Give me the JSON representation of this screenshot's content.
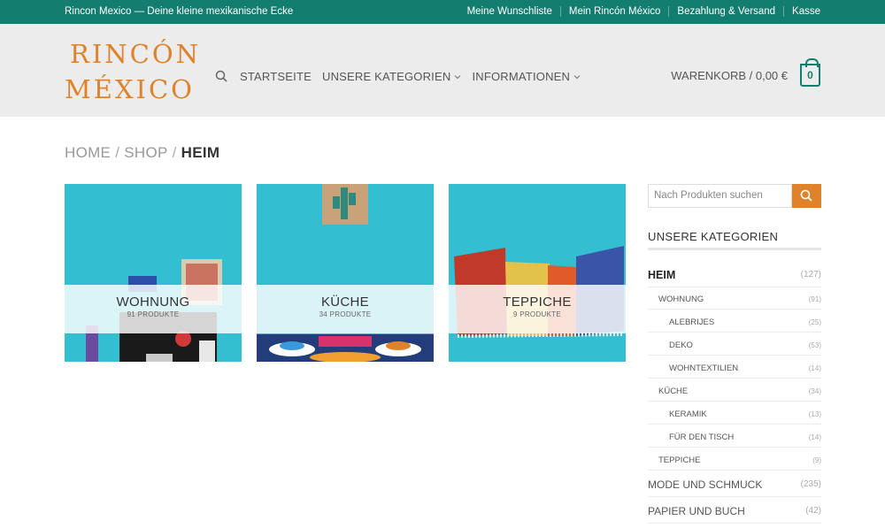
{
  "topbar": {
    "tagline": "Rincon Mexico — Deine kleine mexikanische Ecke",
    "links": [
      "Meine Wunschliste",
      "Mein Rincón México",
      "Bezahlung & Versand",
      "Kasse"
    ]
  },
  "logo": {
    "line1": "RINCÓN",
    "line2": "MÉXICO"
  },
  "nav": {
    "home": "STARTSEITE",
    "categories": "UNSERE KATEGORIEN",
    "info": "INFORMATIONEN"
  },
  "cart": {
    "label": "WARENKORB / 0,00 €",
    "count": "0"
  },
  "breadcrumb": {
    "home": "HOME",
    "shop": "SHOP",
    "current": "HEIM",
    "sep": "/"
  },
  "tiles": [
    {
      "name": "WOHNUNG",
      "count": "91 PRODUKTE"
    },
    {
      "name": "KÜCHE",
      "count": "34 PRODUKTE"
    },
    {
      "name": "TEPPICHE",
      "count": "9 PRODUKTE"
    }
  ],
  "sidebar": {
    "search_placeholder": "Nach Produkten suchen",
    "title": "UNSERE KATEGORIEN",
    "categories": [
      {
        "name": "HEIM",
        "count": "(127)"
      },
      {
        "name": "WOHNUNG",
        "count": "(91)"
      },
      {
        "name": "ALEBRIJES",
        "count": "(25)"
      },
      {
        "name": "DEKO",
        "count": "(53)"
      },
      {
        "name": "WOHNTEXTILIEN",
        "count": "(14)"
      },
      {
        "name": "KÜCHE",
        "count": "(34)"
      },
      {
        "name": "KERAMIK",
        "count": "(13)"
      },
      {
        "name": "FÜR DEN TISCH",
        "count": "(14)"
      },
      {
        "name": "TEPPICHE",
        "count": "(9)"
      },
      {
        "name": "MODE UND SCHMUCK",
        "count": "(235)"
      },
      {
        "name": "PAPIER UND BUCH",
        "count": "(42)"
      }
    ]
  },
  "colors": {
    "topbar": "#137e70",
    "accent": "#e0822a",
    "tile_bg": "#2ebcd0"
  }
}
